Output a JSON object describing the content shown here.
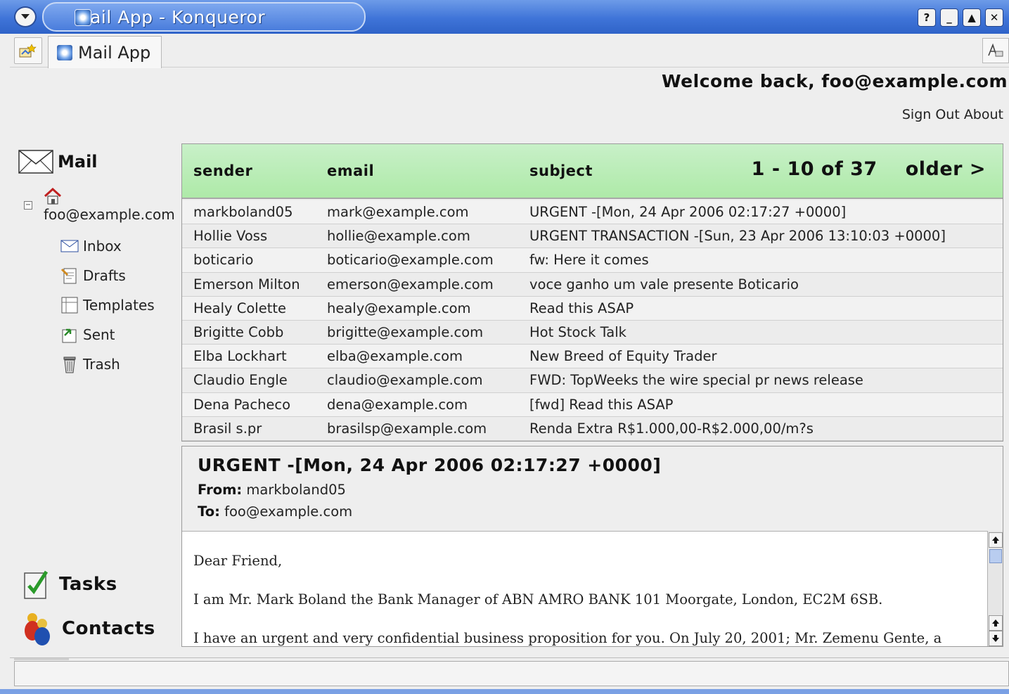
{
  "window": {
    "title": "Mail App - Konqueror",
    "buttons": [
      "?",
      "_",
      "▲",
      "✕"
    ]
  },
  "tabbar": {
    "tab_label": "Mail App"
  },
  "header": {
    "welcome": "Welcome back, foo@example.com",
    "sign_out": "Sign Out",
    "about": "About"
  },
  "sidebar": {
    "mail_label": "Mail",
    "account": "foo@example.com",
    "folders": [
      {
        "label": "Inbox",
        "icon": "envelope-icon"
      },
      {
        "label": "Drafts",
        "icon": "drafts-icon"
      },
      {
        "label": "Templates",
        "icon": "templates-icon"
      },
      {
        "label": "Sent",
        "icon": "sent-icon"
      },
      {
        "label": "Trash",
        "icon": "trash-icon"
      }
    ],
    "tasks_label": "Tasks",
    "contacts_label": "Contacts"
  },
  "list": {
    "columns": {
      "sender": "sender",
      "email": "email",
      "subject": "subject"
    },
    "range": "1 - 10 of 37",
    "older": "older >",
    "rows": [
      {
        "sender": "markboland05",
        "email": "mark@example.com",
        "subject": "URGENT -[Mon, 24 Apr 2006 02:17:27 +0000]"
      },
      {
        "sender": "Hollie Voss",
        "email": "hollie@example.com",
        "subject": "URGENT TRANSACTION -[Sun, 23 Apr 2006 13:10:03 +0000]"
      },
      {
        "sender": "boticario",
        "email": "boticario@example.com",
        "subject": "fw: Here it comes"
      },
      {
        "sender": "Emerson Milton",
        "email": "emerson@example.com",
        "subject": "voce ganho um vale presente Boticario"
      },
      {
        "sender": "Healy Colette",
        "email": "healy@example.com",
        "subject": "Read this ASAP"
      },
      {
        "sender": "Brigitte Cobb",
        "email": "brigitte@example.com",
        "subject": "Hot Stock Talk"
      },
      {
        "sender": "Elba Lockhart",
        "email": "elba@example.com",
        "subject": "New Breed of Equity Trader"
      },
      {
        "sender": "Claudio Engle",
        "email": "claudio@example.com",
        "subject": "FWD: TopWeeks the wire special pr news release"
      },
      {
        "sender": "Dena Pacheco",
        "email": "dena@example.com",
        "subject": "[fwd] Read this ASAP"
      },
      {
        "sender": "Brasil s.pr",
        "email": "brasilsp@example.com",
        "subject": "Renda Extra R$1.000,00-R$2.000,00/m?s"
      }
    ]
  },
  "preview": {
    "subject": "URGENT -[Mon, 24 Apr 2006 02:17:27 +0000]",
    "from_label": "From:",
    "from": "markboland05",
    "to_label": "To:",
    "to": "foo@example.com",
    "body": [
      "Dear Friend,",
      "I am Mr. Mark Boland the Bank Manager of ABN AMRO BANK 101 Moorgate, London, EC2M 6SB.",
      "I have an urgent and very confidential business proposition for you. On July 20, 2001; Mr. Zemenu Gente, a"
    ]
  }
}
